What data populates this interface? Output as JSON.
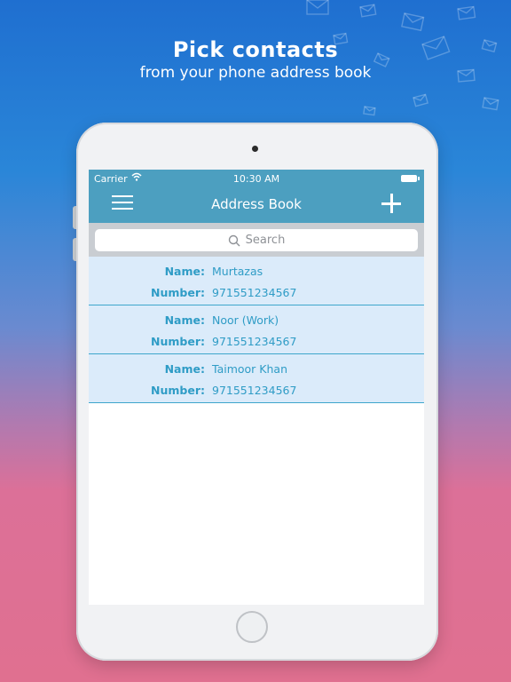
{
  "marketing": {
    "headline": "Pick contacts",
    "subheadline": "from your phone address book"
  },
  "status_bar": {
    "carrier": "Carrier",
    "time": "10:30 AM"
  },
  "navbar": {
    "title": "Address Book",
    "menu_icon": "hamburger-menu-icon",
    "add_icon": "plus-icon"
  },
  "search": {
    "placeholder": "Search"
  },
  "contacts": [
    {
      "name_label": "Name:",
      "name": "Murtazas",
      "number_label": "Number:",
      "number": "971551234567"
    },
    {
      "name_label": "Name:",
      "name": "Noor (Work)",
      "number_label": "Number:",
      "number": "971551234567"
    },
    {
      "name_label": "Name:",
      "name": "Taimoor Khan",
      "number_label": "Number:",
      "number": "971551234567"
    }
  ],
  "colors": {
    "accent": "#4c9fc0",
    "row_background": "#dbebfa",
    "row_text": "#2f9cc6"
  }
}
